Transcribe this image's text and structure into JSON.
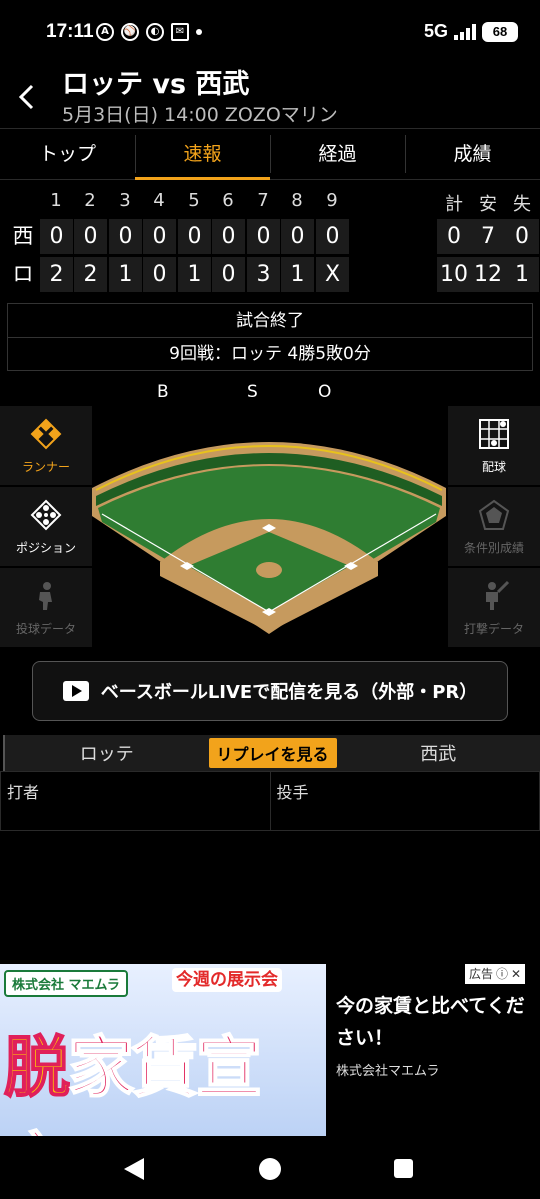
{
  "status_bar": {
    "time": "17:11",
    "network": "5G",
    "battery": "68"
  },
  "header": {
    "title": "ロッテ vs 西武",
    "subtitle": "5月3日(日) 14:00 ZOZOマリン"
  },
  "tabs": [
    {
      "label": "トップ",
      "active": false
    },
    {
      "label": "速報",
      "active": true
    },
    {
      "label": "経過",
      "active": false
    },
    {
      "label": "成績",
      "active": false
    }
  ],
  "scoreboard": {
    "innings": [
      "1",
      "2",
      "3",
      "4",
      "5",
      "6",
      "7",
      "8",
      "9"
    ],
    "totals_headers": [
      "計",
      "安",
      "失"
    ],
    "teams": [
      {
        "label": "西",
        "scores": [
          "0",
          "0",
          "0",
          "0",
          "0",
          "0",
          "0",
          "0",
          "0"
        ],
        "totals": [
          "0",
          "7",
          "0"
        ]
      },
      {
        "label": "ロ",
        "scores": [
          "2",
          "2",
          "1",
          "0",
          "1",
          "0",
          "3",
          "1",
          "X"
        ],
        "totals": [
          "10",
          "12",
          "1"
        ]
      }
    ]
  },
  "result": {
    "status": "試合終了",
    "record": "9回戦：ロッテ 4勝5敗0分"
  },
  "bso": {
    "b": "B",
    "s": "S",
    "o": "O"
  },
  "left_panels": [
    {
      "label": "ランナー",
      "icon": "runner-diamond-icon",
      "active": true
    },
    {
      "label": "ポジション",
      "icon": "position-icon",
      "active": false
    },
    {
      "label": "投球データ",
      "icon": "pitcher-icon",
      "active": false,
      "disabled": true
    }
  ],
  "right_panels": [
    {
      "label": "配球",
      "icon": "pitch-grid-icon",
      "active": false
    },
    {
      "label": "条件別成績",
      "icon": "radar-icon",
      "active": false,
      "disabled": true
    },
    {
      "label": "打撃データ",
      "icon": "batter-icon",
      "active": false,
      "disabled": true
    }
  ],
  "live_button": {
    "label": "ベースボールLIVEで配信を見る（外部・PR）"
  },
  "replay": {
    "home": "ロッテ",
    "button": "リプレイを見る",
    "away": "西武"
  },
  "play_table": {
    "batter": "打者",
    "pitcher": "投手"
  },
  "ad": {
    "mark": "広告",
    "company_tag": "株式会社 マエムラ",
    "weekly": "今週の展示会",
    "big_first": "脱",
    "big_rest": "家賃宣言!",
    "headline": "今の家賃と比べてください！",
    "company": "株式会社マエムラ"
  },
  "colors": {
    "accent": "#f2a31b",
    "field_grass": "#2f7d32",
    "dirt": "#c69a5e"
  }
}
